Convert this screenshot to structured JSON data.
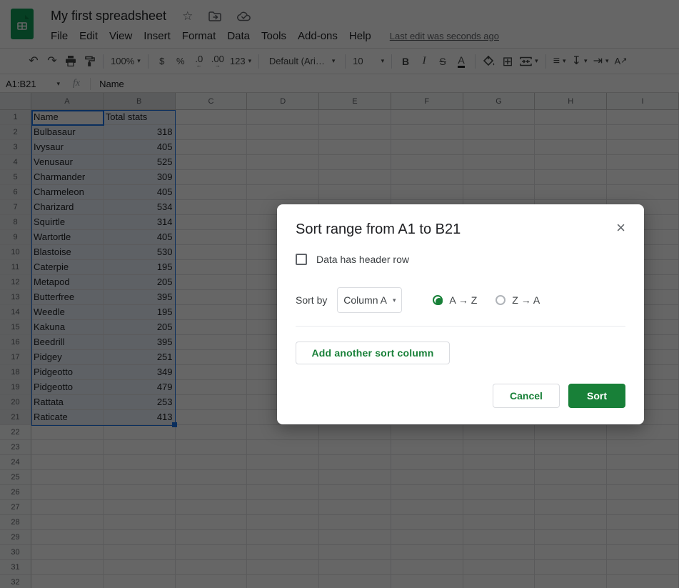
{
  "titlebar": {
    "title": "My first spreadsheet",
    "menus": [
      "File",
      "Edit",
      "View",
      "Insert",
      "Format",
      "Data",
      "Tools",
      "Add-ons",
      "Help"
    ],
    "last_edit": "Last edit was seconds ago"
  },
  "toolbar": {
    "zoom": "100%",
    "currency": "$",
    "percent": "%",
    "decrease_decimal": ".0",
    "increase_decimal": ".00",
    "more_formats": "123",
    "font": "Default (Ari…",
    "font_size": "10",
    "bold": "B",
    "italic": "I",
    "strikethrough": "S",
    "text_color": "A"
  },
  "formula_bar": {
    "range": "A1:B21",
    "fx": "fx",
    "value": "Name"
  },
  "sheet": {
    "columns": [
      "A",
      "B",
      "C",
      "D",
      "E",
      "F",
      "G",
      "H",
      "I"
    ],
    "row_numbers": [
      1,
      2,
      3,
      4,
      5,
      6,
      7,
      8,
      9,
      10,
      11,
      12,
      13,
      14,
      15,
      16,
      17,
      18,
      19,
      20,
      21,
      22,
      23,
      24,
      25,
      26,
      27,
      28,
      29,
      30,
      31,
      32
    ],
    "cells": [
      [
        "Name",
        "Total stats"
      ],
      [
        "Bulbasaur",
        "318"
      ],
      [
        "Ivysaur",
        "405"
      ],
      [
        "Venusaur",
        "525"
      ],
      [
        "Charmander",
        "309"
      ],
      [
        "Charmeleon",
        "405"
      ],
      [
        "Charizard",
        "534"
      ],
      [
        "Squirtle",
        "314"
      ],
      [
        "Wartortle",
        "405"
      ],
      [
        "Blastoise",
        "530"
      ],
      [
        "Caterpie",
        "195"
      ],
      [
        "Metapod",
        "205"
      ],
      [
        "Butterfree",
        "395"
      ],
      [
        "Weedle",
        "195"
      ],
      [
        "Kakuna",
        "205"
      ],
      [
        "Beedrill",
        "395"
      ],
      [
        "Pidgey",
        "251"
      ],
      [
        "Pidgeotto",
        "349"
      ],
      [
        "Pidgeotto",
        "479"
      ],
      [
        "Rattata",
        "253"
      ],
      [
        "Raticate",
        "413"
      ]
    ]
  },
  "dialog": {
    "title": "Sort range from A1 to B21",
    "header_checkbox_label": "Data has header row",
    "sort_by_label": "Sort by",
    "column_value": "Column A",
    "ascending_label": "A → Z",
    "descending_label": "Z → A",
    "add_column_label": "Add another sort column",
    "cancel_label": "Cancel",
    "sort_label": "Sort"
  },
  "colors": {
    "accent_green": "#188038",
    "selection_blue": "#1a73e8",
    "logo_green": "#0f9d58"
  }
}
